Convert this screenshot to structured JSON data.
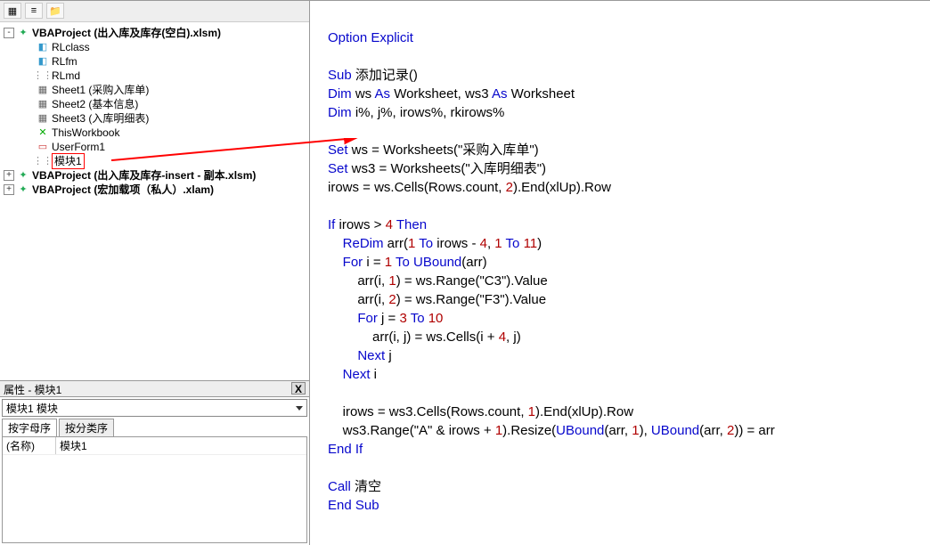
{
  "toolbar": {
    "b1": "▦",
    "b2": "≡",
    "b3": "📁"
  },
  "tree": {
    "p1": "VBAProject (出入库及库存(空白).xlsm)",
    "n_rlclass": "RLclass",
    "n_rlfm": "RLfm",
    "n_rlmd": "RLmd",
    "n_sheet1": "Sheet1 (采购入库单)",
    "n_sheet2": "Sheet2 (基本信息)",
    "n_sheet3": "Sheet3 (入库明细表)",
    "n_thiswb": "ThisWorkbook",
    "n_form1": "UserForm1",
    "n_mod1": "模块1",
    "p2": "VBAProject (出入库及库存-insert - 副本.xlsm)",
    "p3": "VBAProject (宏加载项（私人）.xlam)"
  },
  "props": {
    "title": "属性 - 模块1",
    "combo": "模块1 模块",
    "tab1": "按字母序",
    "tab2": "按分类序",
    "row1k": "(名称)",
    "row1v": "模块1"
  },
  "code": {
    "l1_a": "Option Explicit",
    "l3_a": "Sub",
    "l3_b": " 添加记录()",
    "l4_a": "Dim",
    "l4_b": " ws ",
    "l4_c": "As",
    "l4_d": " Worksheet, ws3 ",
    "l4_e": "As",
    "l4_f": " Worksheet",
    "l5_a": "Dim",
    "l5_b": " i%, j%, irows%, rkirows%",
    "l7_a": "Set",
    "l7_b": " ws = Worksheets(\"采购入库单\")",
    "l8_a": "Set",
    "l8_b": " ws3 = Worksheets(\"入库明细表\")",
    "l9_a": "irows = ws.Cells(Rows.count, ",
    "l9_b": "2",
    "l9_c": ").End(xlUp).Row",
    "l11_a": "If",
    "l11_b": " irows > ",
    "l11_c": "4",
    "l11_d": " ",
    "l11_e": "Then",
    "l12_a": "    ",
    "l12_b": "ReDim",
    "l12_c": " arr(",
    "l12_d": "1",
    "l12_e": " ",
    "l12_f": "To",
    "l12_g": " irows - ",
    "l12_h": "4",
    "l12_i": ", ",
    "l12_j": "1",
    "l12_k": " ",
    "l12_l": "To",
    "l12_m": " ",
    "l12_n": "11",
    "l12_o": ")",
    "l13_a": "    ",
    "l13_b": "For",
    "l13_c": " i = ",
    "l13_d": "1",
    "l13_e": " ",
    "l13_f": "To",
    "l13_g": " ",
    "l13_h": "UBound",
    "l13_i": "(arr)",
    "l14_a": "        arr(i, ",
    "l14_b": "1",
    "l14_c": ") = ws.Range(\"C3\").Value",
    "l15_a": "        arr(i, ",
    "l15_b": "2",
    "l15_c": ") = ws.Range(\"F3\").Value",
    "l16_a": "        ",
    "l16_b": "For",
    "l16_c": " j = ",
    "l16_d": "3",
    "l16_e": " ",
    "l16_f": "To",
    "l16_g": " ",
    "l16_h": "10",
    "l17_a": "            arr(i, j) = ws.Cells(i + ",
    "l17_b": "4",
    "l17_c": ", j)",
    "l18_a": "        ",
    "l18_b": "Next",
    "l18_c": " j",
    "l19_a": "    ",
    "l19_b": "Next",
    "l19_c": " i",
    "l21_a": "    irows = ws3.Cells(Rows.count, ",
    "l21_b": "1",
    "l21_c": ").End(xlUp).Row",
    "l22_a": "    ws3.Range(\"A\" & irows + ",
    "l22_b": "1",
    "l22_c": ").Resize(",
    "l22_d": "UBound",
    "l22_e": "(arr, ",
    "l22_f": "1",
    "l22_g": "), ",
    "l22_h": "UBound",
    "l22_i": "(arr, ",
    "l22_j": "2",
    "l22_k": ")) = arr",
    "l23_a": "End If",
    "l25_a": "Call",
    "l25_b": " 清空",
    "l26_a": "End Sub"
  }
}
